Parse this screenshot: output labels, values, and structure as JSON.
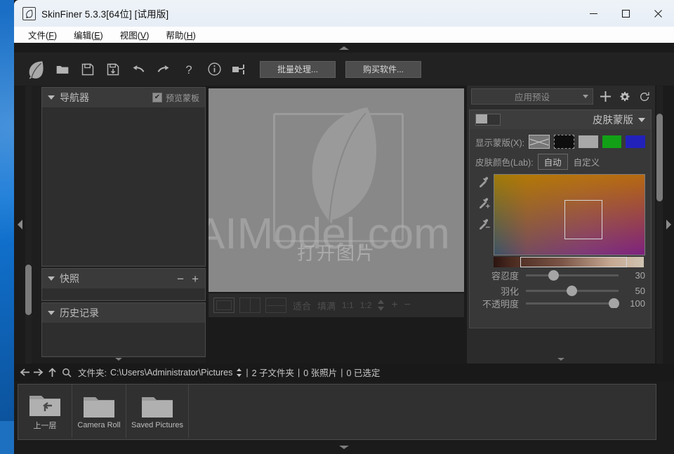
{
  "window": {
    "title": "SkinFiner 5.3.3[64位] [试用版]",
    "app_icon": "leaf-logo-icon",
    "controls": {
      "minimize": "minimize-icon",
      "maximize": "maximize-icon",
      "close": "close-icon"
    }
  },
  "menubar": {
    "items": [
      {
        "label": "文件",
        "accel": "F"
      },
      {
        "label": "编辑",
        "accel": "E"
      },
      {
        "label": "视图",
        "accel": "V"
      },
      {
        "label": "帮助",
        "accel": "H"
      }
    ]
  },
  "toolbar": {
    "icons": [
      "app-leaf-logo",
      "open-folder-icon",
      "save-icon",
      "save-as-icon",
      "undo-icon",
      "redo-icon",
      "help-icon",
      "info-icon",
      "plugin-icon"
    ],
    "batch_button": "批量处理...",
    "buy_button": "购买软件..."
  },
  "left_panel": {
    "navigator": {
      "title": "导航器",
      "checkbox_label": "预览蒙板",
      "checkbox_checked": true,
      "check_glyph": "✔"
    },
    "snapshot": {
      "title": "快照",
      "minus": "−",
      "plus": "+"
    },
    "history": {
      "title": "历史记录"
    }
  },
  "canvas": {
    "open_label": "打开图片",
    "watermark": "AIModel.com"
  },
  "viewbar": {
    "modes": [
      "single-view-icon",
      "side-by-side-view-icon",
      "top-bottom-view-icon"
    ],
    "fit": "适合",
    "fill": "填满",
    "one_to_one": "1:1",
    "one_to_two": "1:2",
    "spinner": "spinner-icon",
    "zoom_in": "+",
    "zoom_out": "−"
  },
  "right_panel": {
    "preset": {
      "select_label": "应用预设",
      "add_icon": "plus-icon",
      "settings_icon": "gear-icon",
      "reset_icon": "refresh-icon"
    },
    "skin_mask": {
      "title": "皮肤蒙版",
      "toggle_on": false,
      "show_mask_label": "显示蒙版(X):",
      "swatches": [
        {
          "name": "none",
          "color": "#777777"
        },
        {
          "name": "black",
          "color": "#0e0e0e"
        },
        {
          "name": "gray",
          "color": "#a8a8a8"
        },
        {
          "name": "green",
          "color": "#12a017"
        },
        {
          "name": "blue",
          "color": "#2222bb"
        }
      ],
      "selected_swatch": "black",
      "skin_color_label": "皮肤颜色(Lab):",
      "auto_button": "自动",
      "custom_button": "自定义",
      "droppers": [
        "eyedropper-icon",
        "eyedropper-add-icon",
        "eyedropper-subtract-icon"
      ],
      "sliders": [
        {
          "label": "容忍度",
          "value": "30",
          "percent": 30
        },
        {
          "label": "羽化",
          "value": "50",
          "percent": 50
        },
        {
          "label": "不透明度",
          "value": "100",
          "percent": 100
        }
      ]
    }
  },
  "pathbar": {
    "back_icon": "arrow-left-icon",
    "forward_icon": "arrow-right-icon",
    "up_icon": "arrow-up-icon",
    "search_icon": "search-icon",
    "folder_label": "文件夹:",
    "path": "C:\\Users\\Administrator\\Pictures",
    "subfolders": "2 子文件夹",
    "photos": "0 张照片",
    "selected": "0 已选定",
    "separator": "|"
  },
  "filmstrip": {
    "items": [
      {
        "caption": "上一层",
        "icon": "folder-up-icon"
      },
      {
        "caption": "Camera Roll",
        "icon": "folder-icon"
      },
      {
        "caption": "Saved Pictures",
        "icon": "folder-icon"
      }
    ]
  },
  "collapse": {
    "top": "collapse-top-arrow",
    "bottom": "collapse-bottom-arrow",
    "left": "collapse-left-arrow",
    "right": "collapse-right-arrow"
  }
}
